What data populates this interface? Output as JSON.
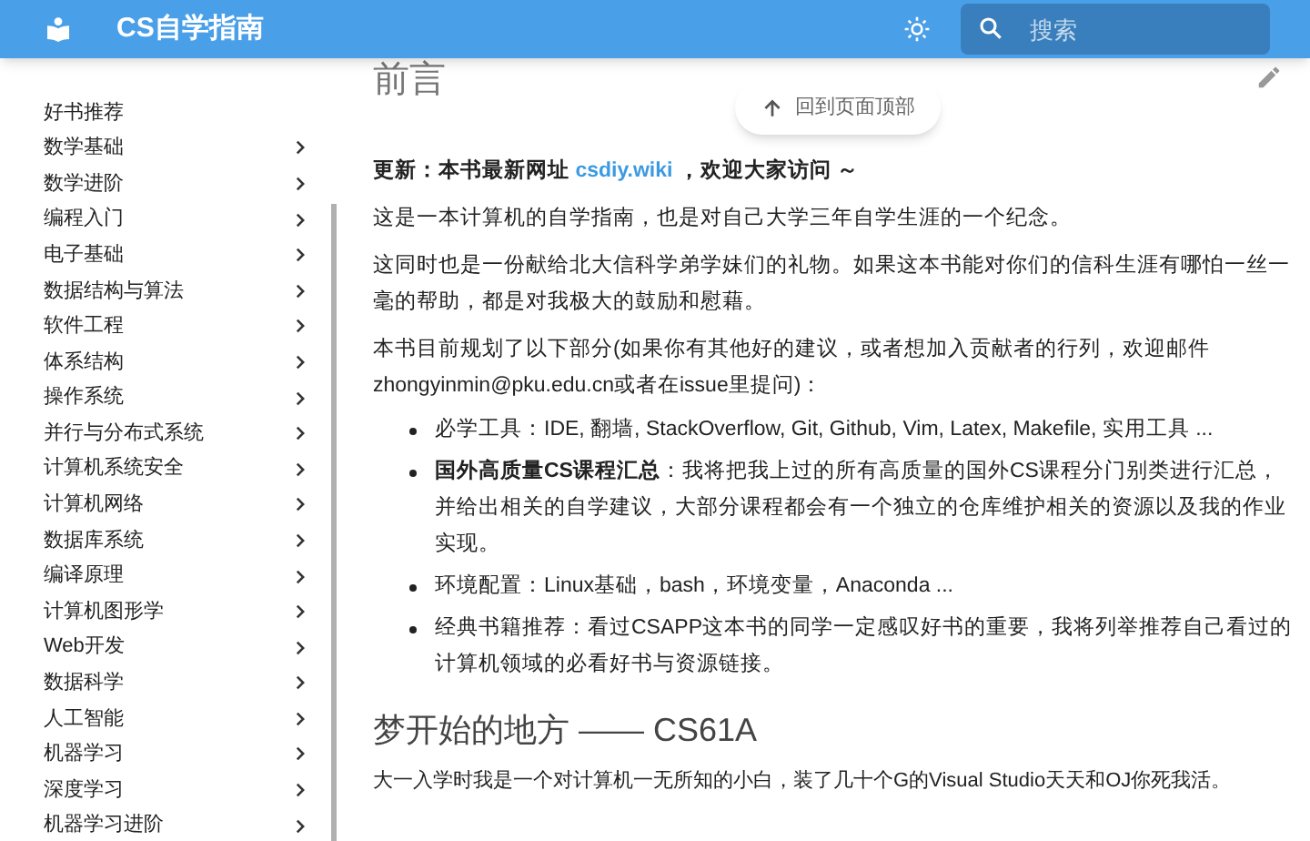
{
  "header": {
    "title": "CS自学指南",
    "search": {
      "placeholder": "搜索"
    }
  },
  "sidebar": {
    "items": [
      {
        "label": "好书推荐",
        "expandable": false
      },
      {
        "label": "数学基础",
        "expandable": true
      },
      {
        "label": "数学进阶",
        "expandable": true
      },
      {
        "label": "编程入门",
        "expandable": true
      },
      {
        "label": "电子基础",
        "expandable": true
      },
      {
        "label": "数据结构与算法",
        "expandable": true
      },
      {
        "label": "软件工程",
        "expandable": true
      },
      {
        "label": "体系结构",
        "expandable": true
      },
      {
        "label": "操作系统",
        "expandable": true
      },
      {
        "label": "并行与分布式系统",
        "expandable": true
      },
      {
        "label": "计算机系统安全",
        "expandable": true
      },
      {
        "label": "计算机网络",
        "expandable": true
      },
      {
        "label": "数据库系统",
        "expandable": true
      },
      {
        "label": "编译原理",
        "expandable": true
      },
      {
        "label": "计算机图形学",
        "expandable": true
      },
      {
        "label": "Web开发",
        "expandable": true
      },
      {
        "label": "数据科学",
        "expandable": true
      },
      {
        "label": "人工智能",
        "expandable": true
      },
      {
        "label": "机器学习",
        "expandable": true
      },
      {
        "label": "深度学习",
        "expandable": true
      },
      {
        "label": "机器学习进阶",
        "expandable": true
      }
    ]
  },
  "back_to_top": "回到页面顶部",
  "content": {
    "title": "前言",
    "update": {
      "before": "更新：本书最新网址",
      "link": "csdiy.wiki",
      "after": "，欢迎大家访问 ～"
    },
    "paragraphs": [
      "这是一本计算机的自学指南，也是对自己大学三年自学生涯的一个纪念。",
      "这同时也是一份献给北大信科学弟学妹们的礼物。如果这本书能对你们的信科生涯有哪怕一丝一毫的帮助，都是对我极大的鼓励和慰藉。",
      "本书目前规划了以下部分(如果你有其他好的建议，或者想加入贡献者的行列，欢迎邮件zhongyinmin@pku.edu.cn或者在issue里提问)："
    ],
    "bullets": [
      "必学工具：IDE, 翻墙, StackOverflow, Git, Github, Vim, Latex, Makefile, 实用工具 ...",
      "**国外高质量CS课程汇总**：我将把我上过的所有高质量的国外CS课程分门别类进行汇总，并给出相关的自学建议，大部分课程都会有一个独立的仓库维护相关的资源以及我的作业实现。",
      "环境配置：Linux基础，bash，环境变量，Anaconda ...",
      "经典书籍推荐：看过CSAPP这本书的同学一定感叹好书的重要，我将列举推荐自己看过的计算机领域的必看好书与资源链接。"
    ],
    "section_title": "梦开始的地方 —— CS61A",
    "section_paragraph": "大一入学时我是一个对计算机一无所知的小白，装了几十个G的Visual Studio天天和OJ你死我活。"
  }
}
